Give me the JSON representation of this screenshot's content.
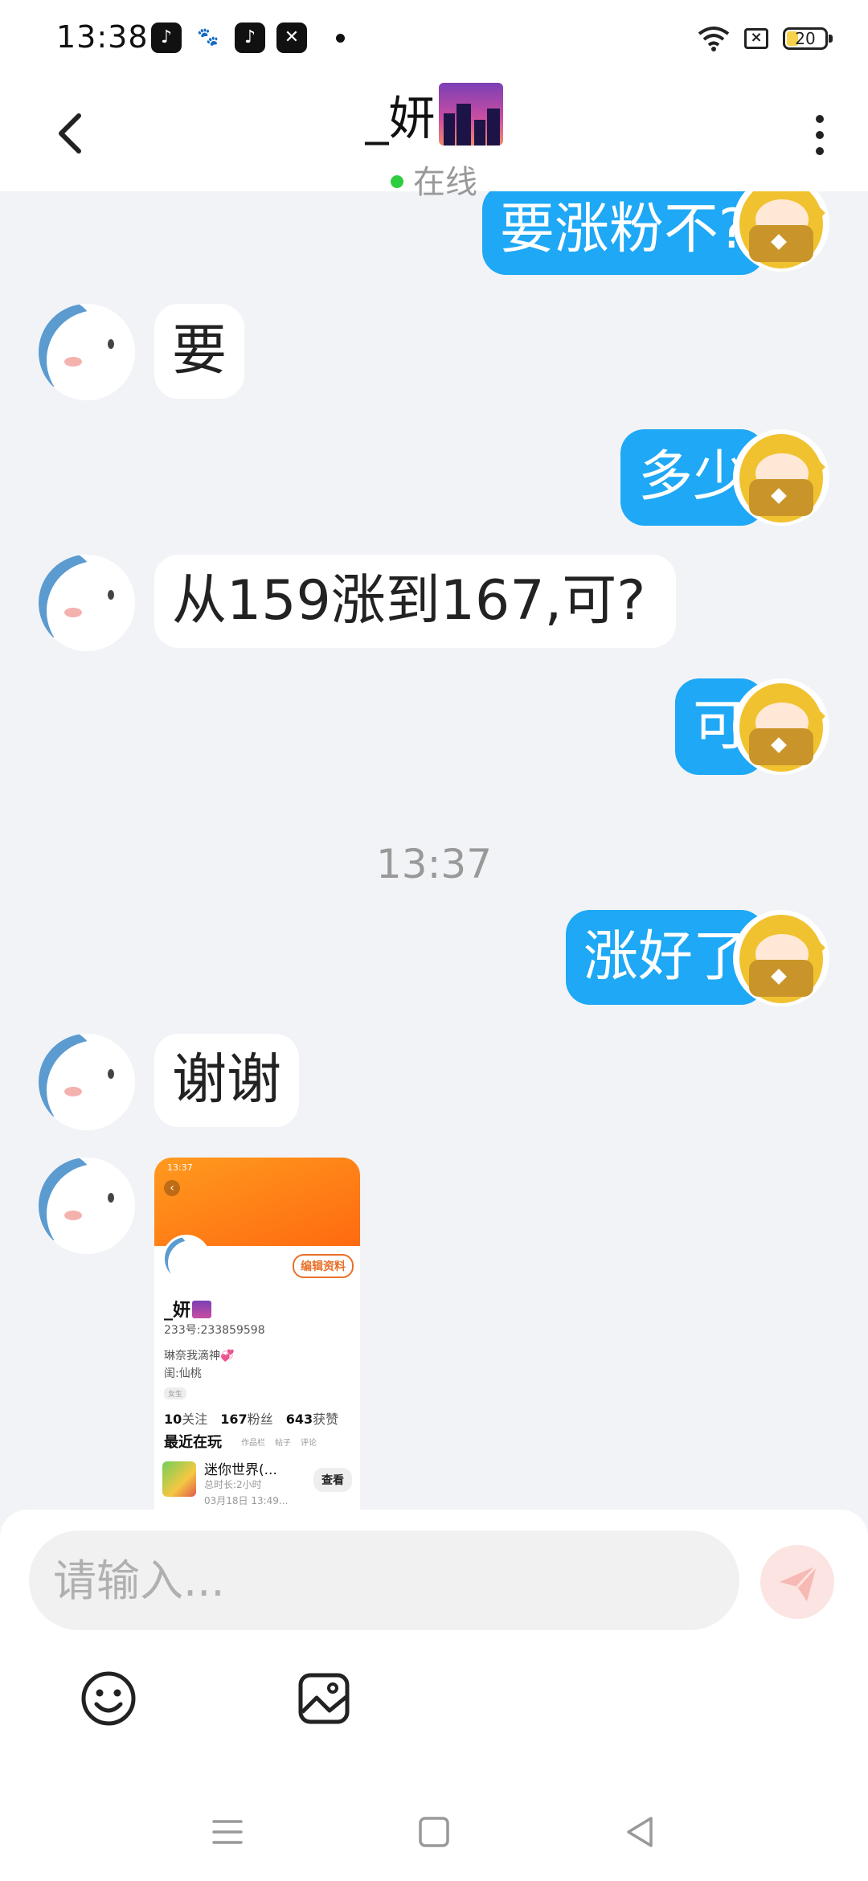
{
  "status_bar": {
    "time": "13:38",
    "apps": [
      "douyin-lite-icon",
      "baidu-icon",
      "douyin-icon",
      "capcut-icon"
    ],
    "battery": "20",
    "icons": [
      "wifi-icon",
      "sim-off-icon",
      "battery-icon"
    ]
  },
  "header": {
    "title": "_妍",
    "status": "在线"
  },
  "messages": [
    {
      "side": "out",
      "text": "要涨粉不?"
    },
    {
      "side": "in",
      "text": "要"
    },
    {
      "side": "out",
      "text": "多少"
    },
    {
      "side": "in",
      "text": "从159涨到167,可?"
    },
    {
      "side": "out",
      "text": "可"
    },
    {
      "side": "out",
      "text": "涨好了"
    },
    {
      "side": "in",
      "text": "谢谢"
    }
  ],
  "time_separator": "13:37",
  "shared_screenshot": {
    "status_time": "13:37",
    "edit_label": "编辑资料",
    "name": "_妍",
    "id_line": "233号:233859598",
    "bio_line1": "琳奈我滴神💞",
    "bio_line2": "闺:仙桃",
    "tag": "女生",
    "following_count": "10",
    "following_label": "关注",
    "fans_count": "167",
    "fans_label": "粉丝",
    "likes_count": "643",
    "likes_label": "获赞",
    "recent_title": "最近在玩",
    "recent_tabs": [
      "作品栏",
      "帖子",
      "评论"
    ],
    "game_name": "迷你世界(...",
    "game_duration": "总时长:2小时",
    "game_time": "03月18日 13:49...",
    "view_label": "查看"
  },
  "input": {
    "placeholder": "请输入..."
  },
  "colors": {
    "outgoing_bubble": "#1ea8f5",
    "incoming_bubble": "#ffffff",
    "chat_background": "#f2f3f7",
    "online_dot": "#2ecc40"
  }
}
